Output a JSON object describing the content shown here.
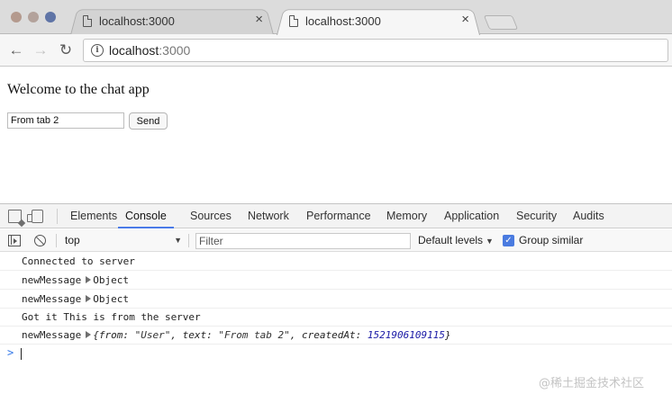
{
  "browser": {
    "tabs": [
      {
        "title": "localhost:3000",
        "active": false
      },
      {
        "title": "localhost:3000",
        "active": true
      }
    ],
    "url_host": "localhost",
    "url_port": ":3000"
  },
  "page": {
    "heading": "Welcome to the chat app",
    "message_input_value": "From tab 2",
    "send_label": "Send"
  },
  "devtools": {
    "tabs": [
      "Elements",
      "Console",
      "Sources",
      "Network",
      "Performance",
      "Memory",
      "Application",
      "Security",
      "Audits"
    ],
    "active_tab": "Console",
    "context": "top",
    "filter_placeholder": "Filter",
    "levels_label": "Default levels",
    "group_similar_label": "Group similar",
    "group_similar_checked": true,
    "accent_color": "#4a7ae8",
    "logs": [
      {
        "text": "Connected to server"
      },
      {
        "label": "newMessage",
        "object": "Object"
      },
      {
        "label": "newMessage",
        "object": "Object"
      },
      {
        "text": "Got it This is from the server"
      },
      {
        "label": "newMessage",
        "open": "{from: ",
        "from": "\"User\"",
        "sep1": ", text: ",
        "text": "\"From tab 2\"",
        "sep2": ", createdAt: ",
        "createdAt": "1521906109115",
        "close": "}"
      }
    ],
    "prompt": ">"
  },
  "watermark": "@稀土掘金技术社区"
}
